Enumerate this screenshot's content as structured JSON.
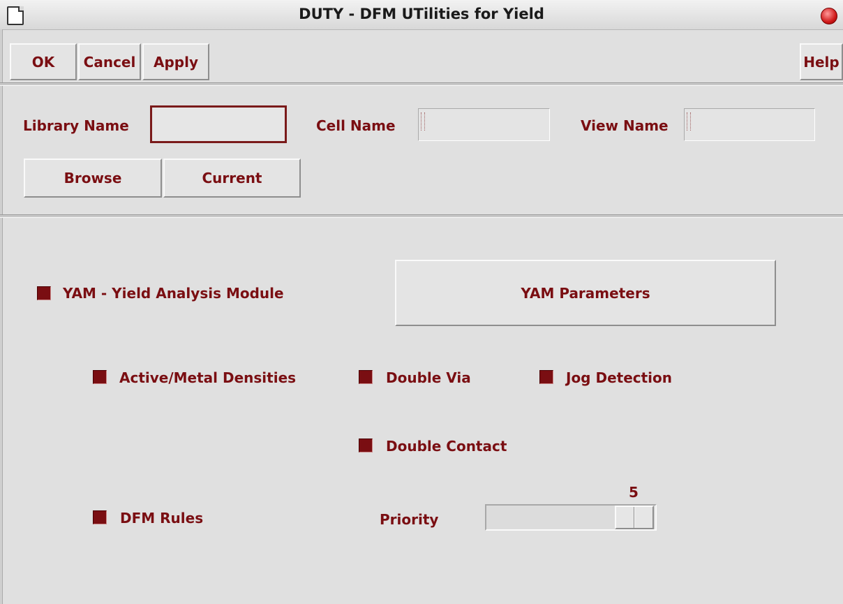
{
  "window": {
    "title": "DUTY - DFM UTilities for Yield"
  },
  "toolbar": {
    "ok_label": "OK",
    "cancel_label": "Cancel",
    "apply_label": "Apply",
    "help_label": "Help"
  },
  "form": {
    "library_label": "Library Name",
    "library_value": "",
    "cell_label": "Cell Name",
    "cell_value": "",
    "view_label": "View Name",
    "view_value": "",
    "browse_label": "Browse",
    "current_label": "Current"
  },
  "options": {
    "yam_label": "YAM - Yield Analysis Module",
    "yam_checked": true,
    "yam_params_label": "YAM Parameters",
    "active_metal_label": "Active/Metal Densities",
    "active_metal_checked": true,
    "double_via_label": "Double Via",
    "double_via_checked": true,
    "jog_label": "Jog Detection",
    "jog_checked": true,
    "double_contact_label": "Double Contact",
    "double_contact_checked": true,
    "dfm_rules_label": "DFM Rules",
    "dfm_rules_checked": true,
    "priority_label": "Priority",
    "priority_value": "5"
  },
  "colors": {
    "accent": "#7a0e12",
    "background": "#e0e0e0"
  }
}
